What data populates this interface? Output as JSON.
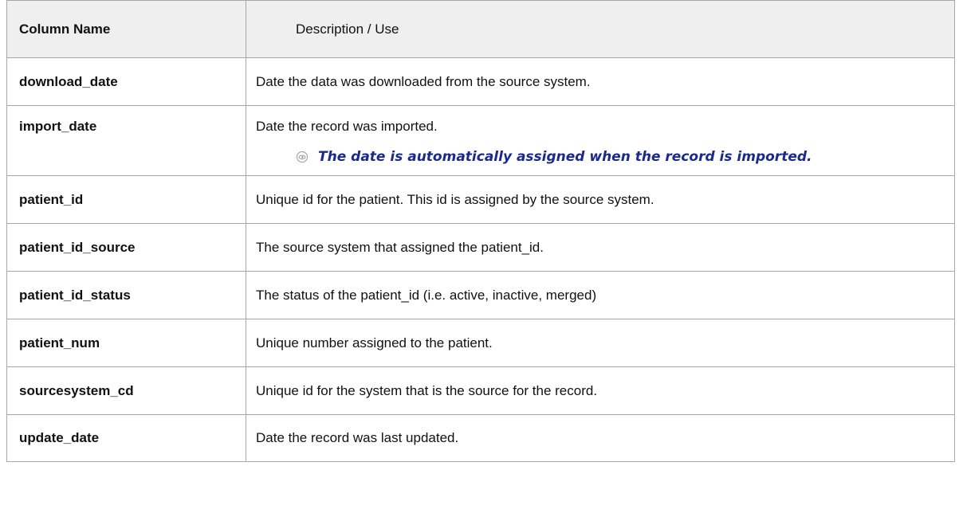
{
  "table": {
    "headers": {
      "column_name": "Column Name",
      "description": "Description / Use"
    },
    "rows": [
      {
        "name": "download_date",
        "description": "Date the data was downloaded from the source system."
      },
      {
        "name": "import_date",
        "description": "Date the record was imported.",
        "note": "The date is automatically assigned when the record is imported."
      },
      {
        "name": "patient_id",
        "description": "Unique id for the patient. This id is assigned by the source system."
      },
      {
        "name": "patient_id_source",
        "description": "The source system that assigned the patient_id."
      },
      {
        "name": "patient_id_status",
        "description": "The status of the patient_id (i.e. active, inactive, merged)"
      },
      {
        "name": "patient_num",
        "description": "Unique number assigned to the patient."
      },
      {
        "name": "sourcesystem_cd",
        "description": "Unique id for the system that is the source for the record."
      },
      {
        "name": "update_date",
        "description": "Date the record was last updated."
      }
    ]
  },
  "colors": {
    "header_background": "#efefef",
    "border": "#a7a7a7",
    "note_text": "#1a2a8c"
  },
  "icons": {
    "note": "note-eye-icon"
  }
}
